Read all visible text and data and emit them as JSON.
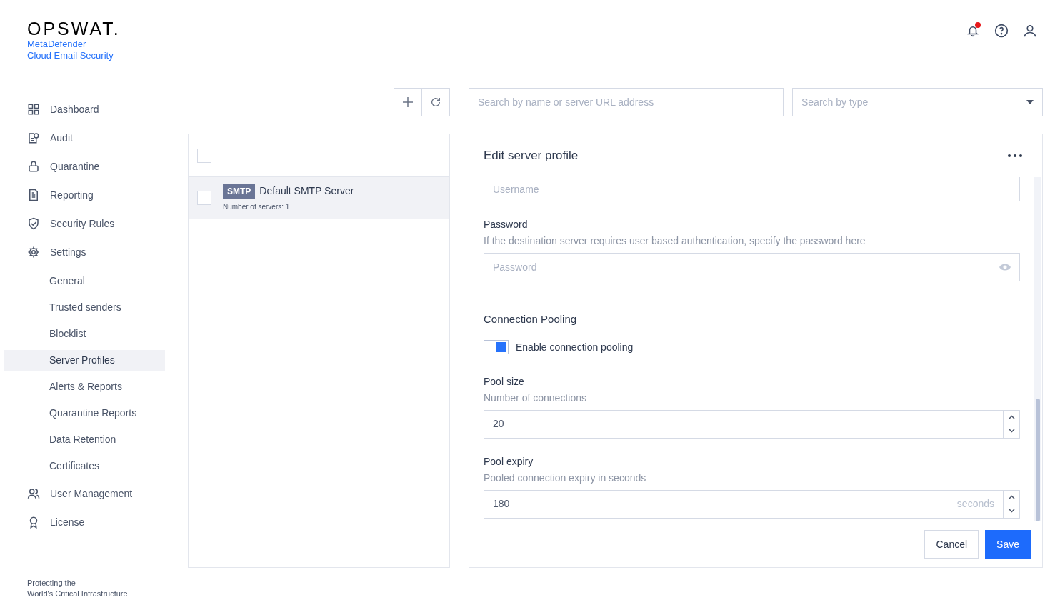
{
  "brand": {
    "logo": "OPSWAT.",
    "product": "MetaDefender",
    "subtitle": "Cloud Email Security"
  },
  "header": {
    "notification_badge": true
  },
  "sidebar": {
    "items": [
      {
        "label": "Dashboard",
        "selected": false
      },
      {
        "label": "Audit",
        "selected": false
      },
      {
        "label": "Quarantine",
        "selected": false
      },
      {
        "label": "Reporting",
        "selected": false
      },
      {
        "label": "Security Rules",
        "selected": false
      },
      {
        "label": "Settings",
        "selected": false,
        "children": [
          {
            "label": "General",
            "selected": false
          },
          {
            "label": "Trusted senders",
            "selected": false
          },
          {
            "label": "Blocklist",
            "selected": false
          },
          {
            "label": "Server Profiles",
            "selected": true
          },
          {
            "label": "Alerts & Reports",
            "selected": false
          },
          {
            "label": "Quarantine Reports",
            "selected": false
          },
          {
            "label": "Data Retention",
            "selected": false
          },
          {
            "label": "Certificates",
            "selected": false
          }
        ]
      },
      {
        "label": "User Management",
        "selected": false
      },
      {
        "label": "License",
        "selected": false
      }
    ],
    "footer": [
      "Protecting the",
      "World's Critical Infrastructure"
    ]
  },
  "search": {
    "placeholder": "Search by name or server URL address"
  },
  "type_filter": {
    "placeholder": "Search by type"
  },
  "server_list": {
    "select_all_checked": false,
    "rows": [
      {
        "tag": "SMTP",
        "name": "Default SMTP Server",
        "detail": "Number of servers: 1",
        "selected": true,
        "checked": false
      }
    ]
  },
  "editor": {
    "title": "Edit server profile",
    "username": {
      "placeholder": "Username"
    },
    "password": {
      "label": "Password",
      "description": "If the destination server requires user based authentication, specify the password here",
      "placeholder": "Password"
    },
    "section": "Connection Pooling",
    "pooling_toggle": {
      "label": "Enable connection pooling",
      "on": true
    },
    "pool_size": {
      "label": "Pool size",
      "description": "Number of connections",
      "value": "20"
    },
    "pool_expiry": {
      "label": "Pool expiry",
      "description": "Pooled connection expiry in seconds",
      "value": "180",
      "unit": "seconds"
    },
    "buttons": [
      "Cancel",
      "Save"
    ]
  }
}
